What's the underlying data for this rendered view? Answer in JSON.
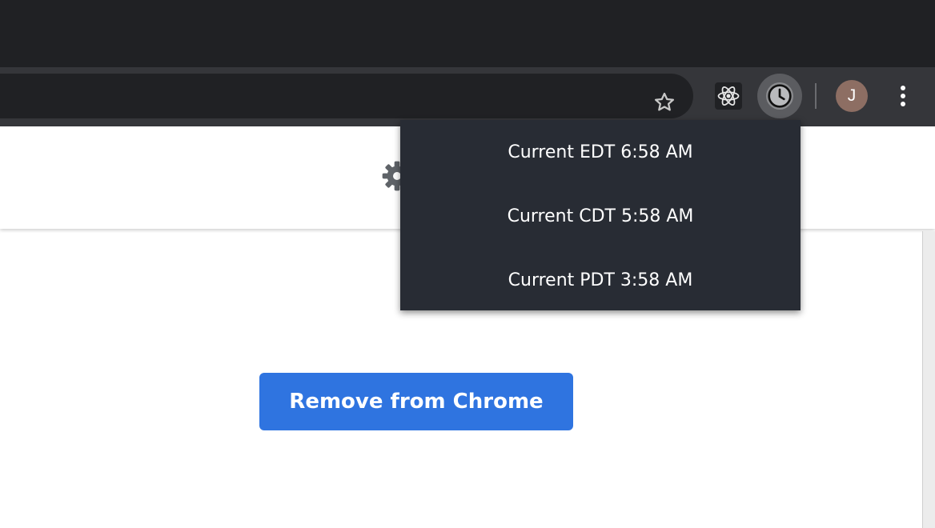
{
  "browser": {
    "toolbar": {
      "bookmark_icon": "star-outline-icon",
      "extensions": [
        {
          "name": "React Developer Tools",
          "icon": "react-icon"
        },
        {
          "name": "Time zone clock",
          "icon": "clock-icon",
          "active": true
        }
      ],
      "profile": {
        "initial": "J",
        "color": "#8d6e63"
      },
      "menu_icon": "more-vert-icon"
    }
  },
  "page": {
    "header_icon": "gear-icon",
    "remove_button_label": "Remove from Chrome",
    "accent_color": "#2f74e0"
  },
  "popup": {
    "times": [
      {
        "label": "Current EDT 6:58 AM"
      },
      {
        "label": "Current CDT 5:58 AM"
      },
      {
        "label": "Current PDT 3:58 AM"
      }
    ]
  }
}
